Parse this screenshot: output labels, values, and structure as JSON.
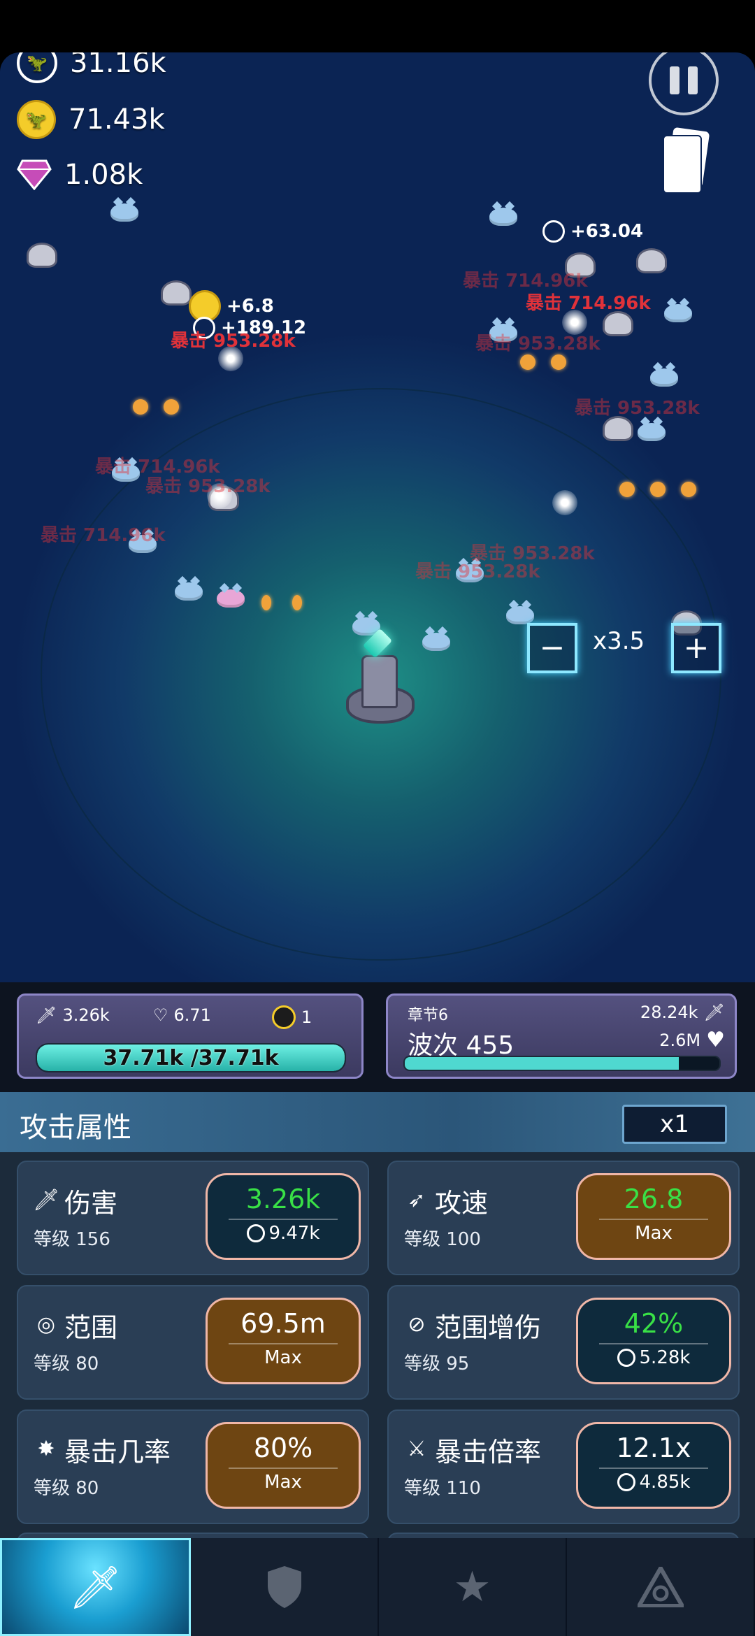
{
  "resources": {
    "res1": "31.16k",
    "res2": "71.43k",
    "gems": "1.08k"
  },
  "floating_texts": {
    "plus1": "+63.04",
    "plus2": "+6.8",
    "plus3": "+189.12",
    "dmg1": "暴击 714.96k",
    "dmg2": "暴击 714.96k",
    "dmg3": "暴击 953.28k",
    "dmg4": "暴击 953.28k",
    "dmg5": "暴击 953.28k",
    "dmg6": "暴击 714.96k",
    "dmg7": "暴击 953.28k",
    "dmg8": "暴击 714.96k",
    "dmg9": "暴击 953.28k",
    "dmg10": "暴击 953.28k"
  },
  "zoom": {
    "label": "x3.5",
    "minus": "−",
    "plus": "+"
  },
  "status_left": {
    "attack": "3.26k",
    "regen": "6.71",
    "coin": "1",
    "hp": "37.71k /37.71k",
    "hp_fraction": 1.0
  },
  "status_right": {
    "chapter": "章节6",
    "wave": "波次 455",
    "enemy_attack": "28.24k",
    "enemy_hp": "2.6M",
    "wave_progress": 0.87
  },
  "attributes": {
    "title": "攻击属性",
    "multiplier": "x1",
    "cards": [
      {
        "name": "伤害",
        "level": "等级 156",
        "value": "3.26k",
        "cost": "9.47k",
        "icon": "sword-icon"
      },
      {
        "name": "攻速",
        "level": "等级 100",
        "value": "26.8",
        "cost": "Max",
        "icon": "wing-icon"
      },
      {
        "name": "范围",
        "level": "等级 80",
        "value": "69.5m",
        "cost": "Max",
        "icon": "target-icon"
      },
      {
        "name": "范围增伤",
        "level": "等级 95",
        "value": "42%",
        "cost": "5.28k",
        "icon": "range-damage-icon"
      },
      {
        "name": "暴击几率",
        "level": "等级 80",
        "value": "80%",
        "cost": "Max",
        "icon": "crit-icon"
      },
      {
        "name": "暴击倍率",
        "level": "等级 110",
        "value": "12.1x",
        "cost": "4.85k",
        "icon": "crit-multiplier-icon"
      }
    ]
  },
  "colors": {
    "value_green": "#39e046",
    "value_white": "#ffffff",
    "amber_btn": "#6e4512",
    "accent_cyan": "#4fd8d0"
  },
  "nav": [
    "sword-icon",
    "shield-icon",
    "star-icon",
    "eye-triangle-icon"
  ]
}
